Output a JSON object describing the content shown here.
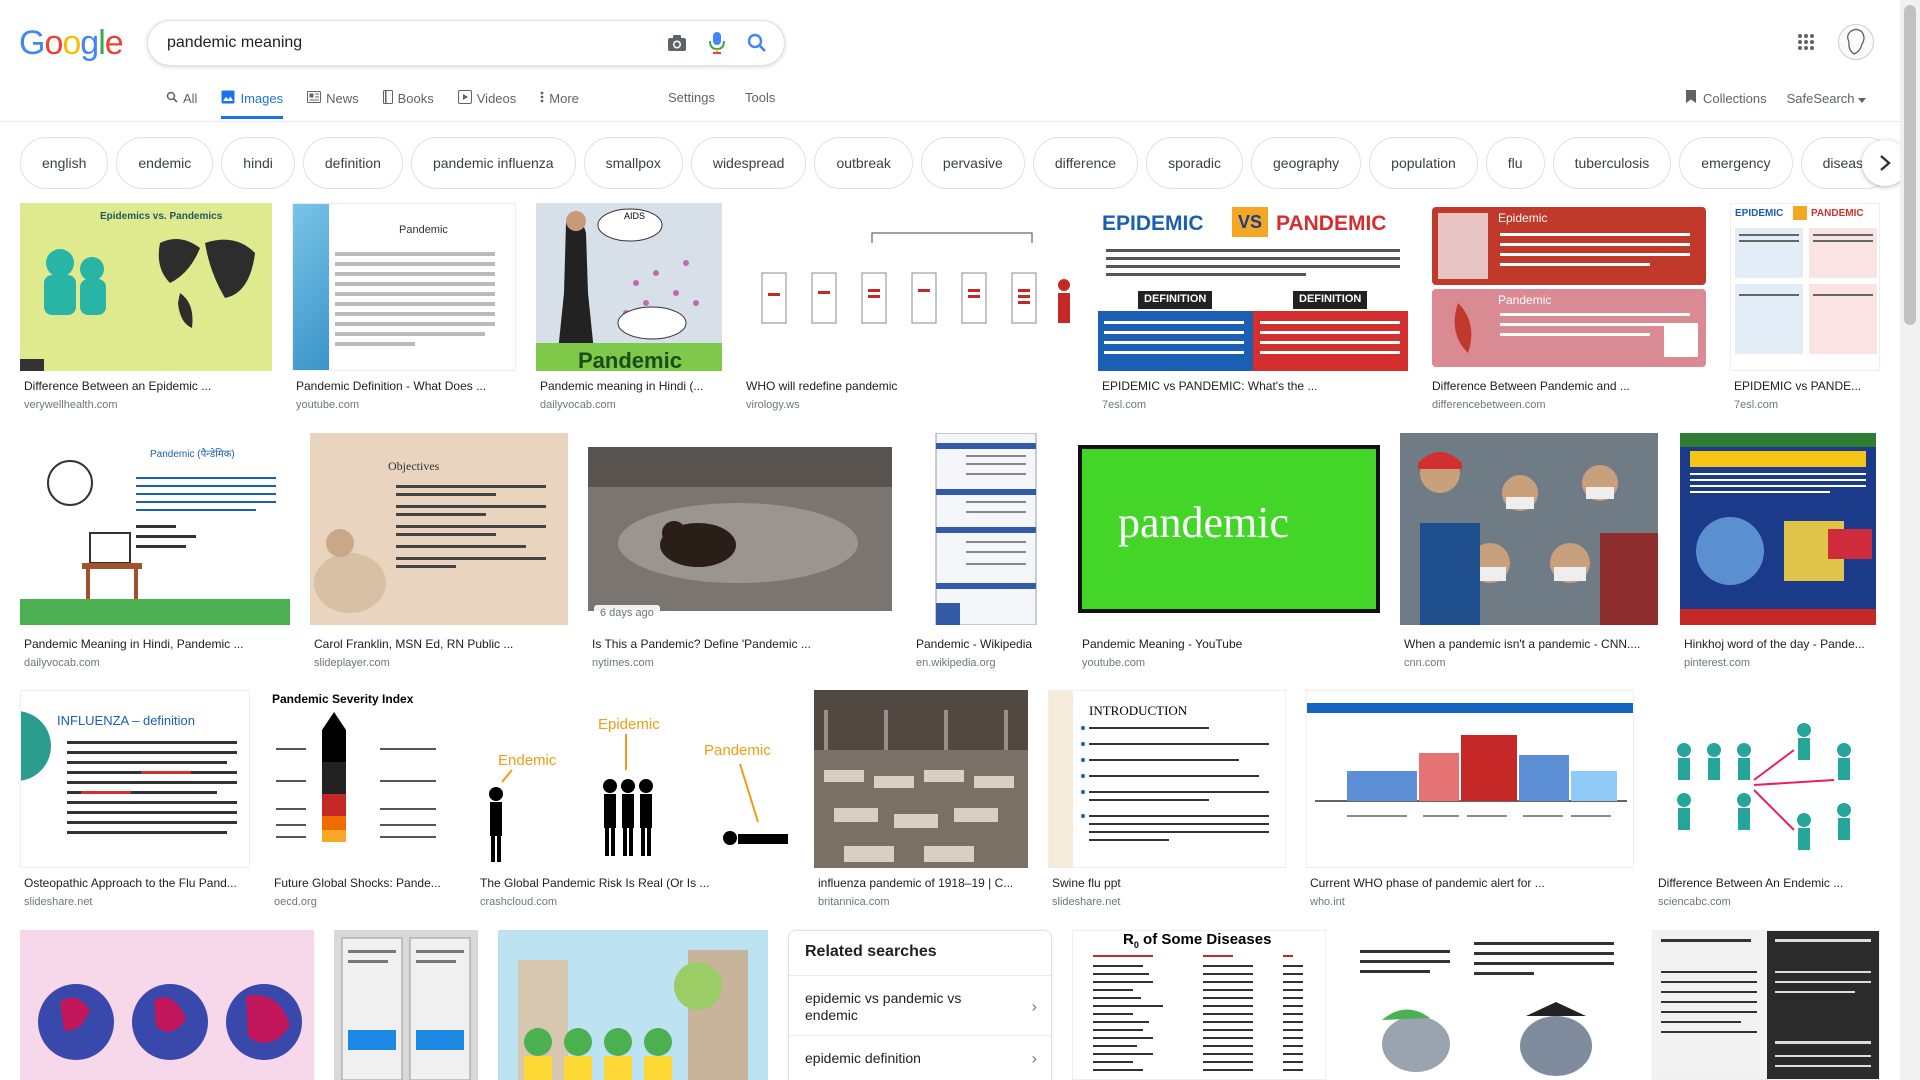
{
  "logo": {
    "letters": [
      "G",
      "o",
      "o",
      "g",
      "l",
      "e"
    ],
    "colors": [
      "#4285F4",
      "#EA4335",
      "#FBBC05",
      "#4285F4",
      "#34A853",
      "#EA4335"
    ]
  },
  "search": {
    "query": "pandemic meaning"
  },
  "icons": {
    "camera": "camera-icon",
    "mic": "mic-icon",
    "search": "search-icon",
    "apps": "apps-grid-icon"
  },
  "tabs": [
    {
      "label": "All",
      "icon": "search-icon"
    },
    {
      "label": "Images",
      "icon": "image-icon"
    },
    {
      "label": "News",
      "icon": "news-icon"
    },
    {
      "label": "Books",
      "icon": "book-icon"
    },
    {
      "label": "Videos",
      "icon": "video-icon"
    },
    {
      "label": "More",
      "icon": "more-icon"
    }
  ],
  "tools": {
    "settings": "Settings",
    "tools": "Tools"
  },
  "header_right": {
    "collections": "Collections",
    "safesearch": "SafeSearch"
  },
  "chips": [
    "english",
    "endemic",
    "hindi",
    "definition",
    "pandemic influenza",
    "smallpox",
    "widespread",
    "outbreak",
    "pervasive",
    "difference",
    "sporadic",
    "geography",
    "population",
    "flu",
    "tuberculosis",
    "emergency",
    "disease"
  ],
  "results": [
    {
      "caption": "Difference Between an Epidemic ...",
      "source": "verywellhealth.com"
    },
    {
      "caption": "Pandemic Definition - What Does ...",
      "source": "youtube.com"
    },
    {
      "caption": "Pandemic meaning in Hindi (...",
      "source": "dailyvocab.com"
    },
    {
      "caption": "WHO will redefine pandemic",
      "source": "virology.ws"
    },
    {
      "caption": "EPIDEMIC vs PANDEMIC: What's the ...",
      "source": "7esl.com"
    },
    {
      "caption": "Difference Between Pandemic and ...",
      "source": "differencebetween.com"
    },
    {
      "caption": "EPIDEMIC vs PANDE...",
      "source": "7esl.com"
    },
    {
      "caption": "Pandemic Meaning in Hindi, Pandemic ...",
      "source": "dailyvocab.com"
    },
    {
      "caption": "Carol Franklin, MSN Ed, RN Public ...",
      "source": "slideplayer.com"
    },
    {
      "caption": "Is This a Pandemic? Define 'Pandemic ...",
      "source": "nytimes.com",
      "badge": "6 days ago"
    },
    {
      "caption": "Pandemic - Wikipedia",
      "source": "en.wikipedia.org"
    },
    {
      "caption": "Pandemic Meaning - YouTube",
      "source": "youtube.com"
    },
    {
      "caption": "When a pandemic isn't a pandemic - CNN....",
      "source": "cnn.com"
    },
    {
      "caption": "Hinkhoj word of the day - Pande...",
      "source": "pinterest.com"
    },
    {
      "caption": "Osteopathic Approach to the Flu Pand...",
      "source": "slideshare.net"
    },
    {
      "caption": "Future Global Shocks: Pande...",
      "source": "oecd.org"
    },
    {
      "caption": "The Global Pandemic Risk Is Real (Or Is ...",
      "source": "crashcloud.com"
    },
    {
      "caption": "influenza pandemic of 1918–19 | C...",
      "source": "britannica.com"
    },
    {
      "caption": "Swine flu ppt",
      "source": "slideshare.net"
    },
    {
      "caption": "Current WHO phase of pandemic alert for ...",
      "source": "who.int"
    },
    {
      "caption": "Difference Between An Endemic ...",
      "source": "sciencabc.com"
    }
  ],
  "thumb_text": {
    "t1_title": "Epidemics vs. Pandemics",
    "t2_title": "Pandemic",
    "t3_big": "Pandemic",
    "t3_aids": "AIDS",
    "t5_epi": "EPIDEMIC",
    "t5_vs": "VS",
    "t5_pan": "PANDEMIC",
    "t5_def": "DEFINITION",
    "t6_epi": "Epidemic",
    "t6_pan": "Pandemic",
    "t8_title": "Pandemic (पैन्डेमिक)",
    "t9_title": "Objectives",
    "t12_word": "pandemic",
    "t15_title": "INFLUENZA – definition",
    "t16_title": "Pandemic Severity Index",
    "t17_endemic": "Endemic",
    "t17_epidemic": "Epidemic",
    "t17_pandemic": "Pandemic",
    "t19_title": "INTRODUCTION",
    "t22_title": "R",
    "t22_sub": "0",
    "t22_rest": " of Some Diseases"
  },
  "related": {
    "title": "Related searches",
    "items": [
      "epidemic vs pandemic vs endemic",
      "epidemic definition"
    ]
  }
}
